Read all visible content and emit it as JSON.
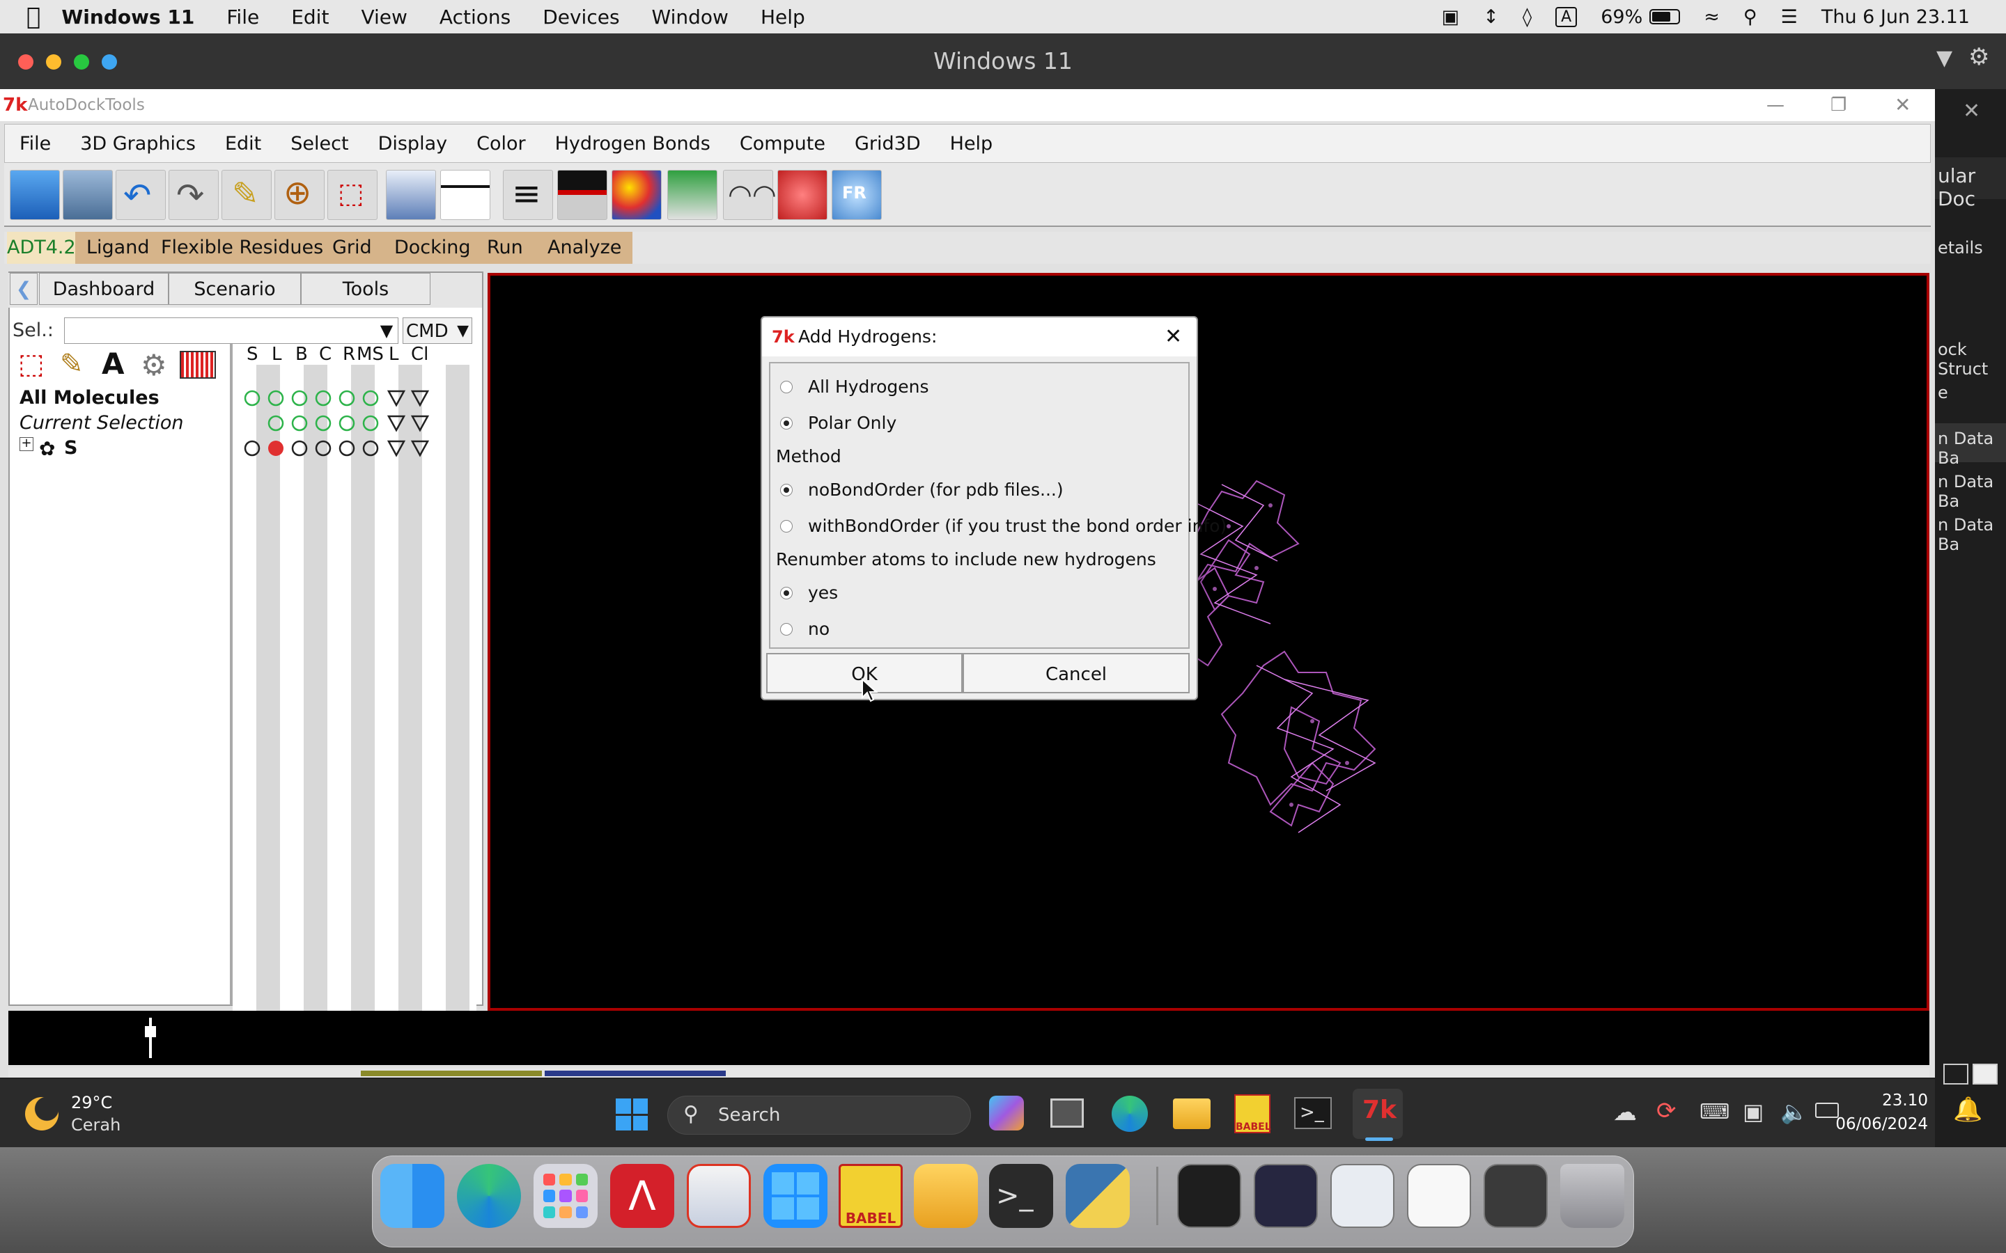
{
  "mac_menu": {
    "app_name": "Windows 11",
    "items": [
      "File",
      "Edit",
      "View",
      "Actions",
      "Devices",
      "Window",
      "Help"
    ]
  },
  "mac_status": {
    "battery": "69%",
    "datetime": "Thu 6 Jun  23.11",
    "input_source": "A"
  },
  "vm_window": {
    "title": "Windows 11"
  },
  "adt": {
    "title": "AutoDockTools",
    "menus": [
      "File",
      "3D Graphics",
      "Edit",
      "Select",
      "Display",
      "Color",
      "Hydrogen Bonds",
      "Compute",
      "Grid3D",
      "Help"
    ],
    "adt_bar": [
      "ADT4.2",
      "Ligand",
      "Flexible Residues",
      "Grid",
      "Docking",
      "Run",
      "Analyze"
    ],
    "tabs": [
      "Dashboard",
      "Scenario",
      "Tools"
    ],
    "sel_label": "Sel.:",
    "sel_value": "",
    "cmd_label": "CMD",
    "columns": [
      "S",
      "L",
      "B",
      "C",
      "R",
      "MS",
      "L",
      "Cl"
    ],
    "tree": {
      "all_molecules": "All Molecules",
      "current_selection": "Current Selection",
      "molecule": "S"
    }
  },
  "dialog": {
    "title": "Add Hydrogens:",
    "options": {
      "all_hydrogens": "All Hydrogens",
      "polar_only": "Polar Only"
    },
    "method_label": "Method",
    "method_options": {
      "no_bond_order": "noBondOrder (for pdb files...)",
      "with_bond_order": "withBondOrder (if you trust the bond order info)"
    },
    "renumber_label": "Renumber atoms to include new hydrogens",
    "renumber_options": {
      "yes": "yes",
      "no": "no"
    },
    "ok": "OK",
    "cancel": "Cancel"
  },
  "right_sidebar": {
    "items": [
      "ular Doc",
      "etails",
      "ock Struct",
      "e",
      "n Data Ba",
      "n Data Ba",
      "n Data Ba"
    ]
  },
  "taskbar": {
    "weather_temp": "29°C",
    "weather_desc": "Cerah",
    "search_placeholder": "Search",
    "time": "23.10",
    "date": "06/06/2024"
  },
  "dock": {
    "babel_label": "BABEL"
  },
  "colors": {
    "viewer_border": "#a80000",
    "molecule": "#d070e0",
    "status_green": "#2db34a",
    "status_red": "#e03030"
  }
}
